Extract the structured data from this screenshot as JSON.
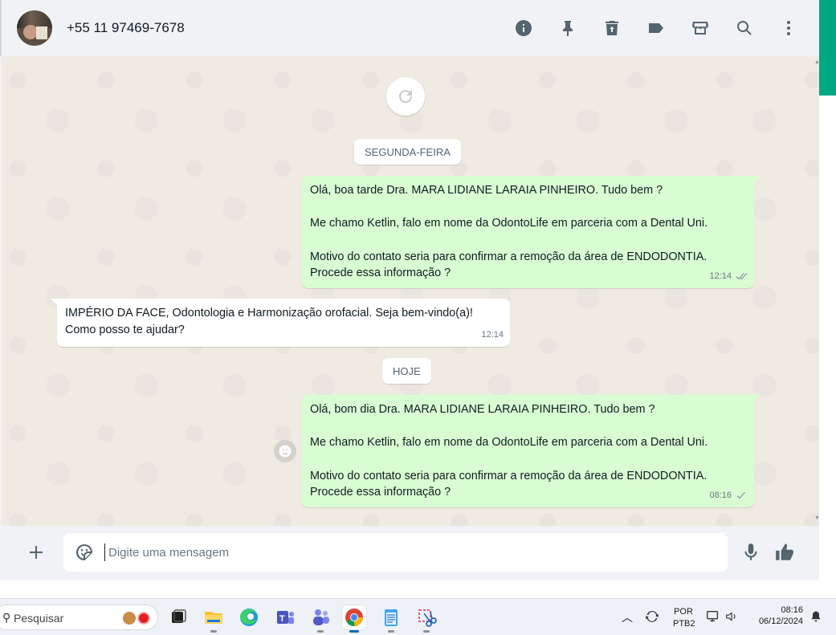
{
  "header": {
    "contact_name": "+55 11 97469-7678",
    "icons": [
      "info-icon",
      "pin-icon",
      "delete-icon",
      "label-icon",
      "store-icon",
      "search-icon",
      "menu-icon"
    ]
  },
  "chat": {
    "date_chips": [
      "SEGUNDA-FEIRA",
      "HOJE"
    ],
    "messages": [
      {
        "direction": "out",
        "lines": [
          "Olá, boa tarde Dra. MARA LIDIANE LARAIA PINHEIRO. Tudo bem ?",
          "",
          "Me chamo Ketlin, falo em nome da OdontoLife em parceria com a Dental Uni.",
          "",
          "Motivo do contato seria para confirmar a remoção da área de ENDODONTIA.",
          "Procede essa informação ?"
        ],
        "time": "12:14",
        "status": "read-double-check"
      },
      {
        "direction": "in",
        "lines": [
          "IMPÉRIO DA  FACE, Odontologia e Harmonização  orofacial. Seja bem-vindo(a)!",
          "Como posso te ajudar?"
        ],
        "time": "12:14"
      },
      {
        "direction": "out",
        "lines": [
          "Olá, bom dia Dra. MARA LIDIANE LARAIA PINHEIRO. Tudo bem ?",
          "",
          "Me chamo Ketlin, falo em nome da OdontoLife em parceria com a Dental Uni.",
          "",
          "Motivo do contato seria para confirmar a remoção da área de ENDODONTIA.",
          "Procede essa informação ?"
        ],
        "time": "08:16",
        "status": "sent-single-check"
      }
    ]
  },
  "composer": {
    "placeholder": "Digite uma mensagem",
    "value": ""
  },
  "taskbar": {
    "search_label": "Pesquisar",
    "apps": [
      "task-view",
      "file-explorer",
      "edge",
      "teams-classic",
      "teams",
      "chrome",
      "notepad",
      "snipping-tool"
    ],
    "active_app": "chrome",
    "language_line1": "POR",
    "language_line2": "PTB2",
    "time": "08:16",
    "date": "06/12/2024"
  },
  "colors": {
    "accent": "#00a884",
    "outgoing_bubble": "#d9fdd3",
    "chat_background": "#efeae2"
  }
}
